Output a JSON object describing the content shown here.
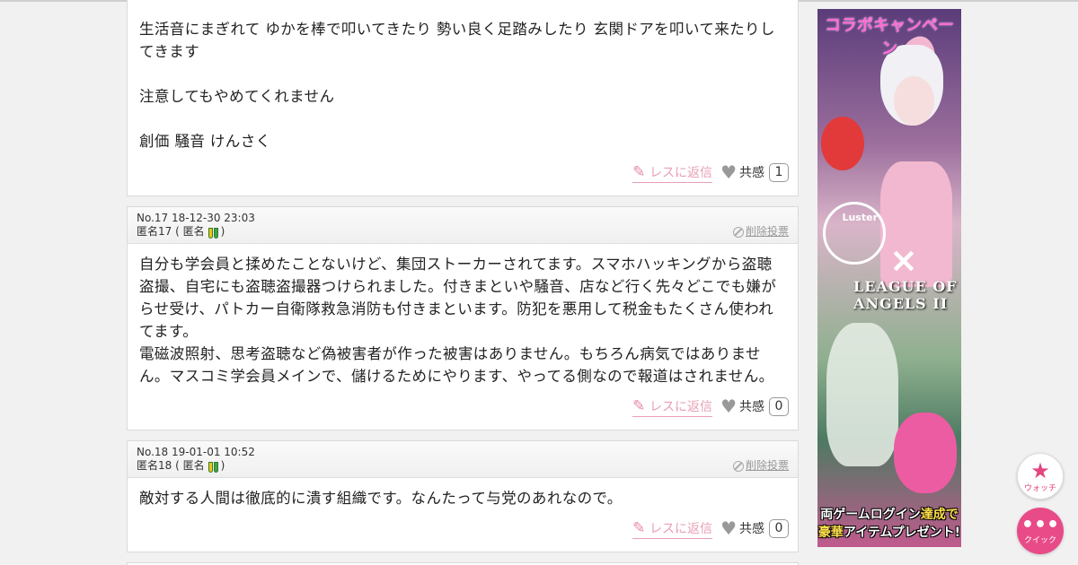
{
  "posts": [
    {
      "lines": [
        "生活音にまぎれて ゆかを棒で叩いてきたり 勢い良く足踏みしたり 玄関ドアを叩いて来たりしてきます",
        "",
        "注意してもやめてくれません",
        "",
        "創価 騒音 けんさく"
      ],
      "reply_label": "レスに返信",
      "sympathy_label": "共感",
      "sympathy_count": "1"
    },
    {
      "meta": "No.17 18-12-30 23:03",
      "author": "匿名17 ( 匿名",
      "author_close": ")",
      "delete_label": "削除投票",
      "lines": [
        "自分も学会員と揉めたことないけど、集団ストーカーされてます。スマホハッキングから盗聴盗撮、自宅にも盗聴盗撮器つけられました。付きまといや騒音、店など行く先々どこでも嫌がらせ受け、パトカー自衛隊救急消防も付きまといます。防犯を悪用して税金もたくさん使われてます。",
        "電磁波照射、思考盗聴など偽被害者が作った被害はありません。もちろん病気ではありません。マスコミ学会員メインで、儲けるためにやります、やってる側なので報道はされません。"
      ],
      "reply_label": "レスに返信",
      "sympathy_label": "共感",
      "sympathy_count": "0"
    },
    {
      "meta": "No.18 19-01-01 10:52",
      "author": "匿名18 ( 匿名",
      "author_close": ")",
      "delete_label": "削除投票",
      "lines": [
        "敵対する人間は徹底的に潰す組織です。なんたって与党のあれなので。"
      ],
      "reply_label": "レスに返信",
      "sympathy_label": "共感",
      "sympathy_count": "0"
    }
  ],
  "ad": {
    "title": "コラボキャンペーン",
    "logo1": "Luster",
    "logo2": "LEAGUE OF ANGELS II",
    "footer_line1_a": "両ゲームログイン",
    "footer_line1_b": "達成で",
    "footer_line2_a": "豪華",
    "footer_line2_b": "アイテムプレゼント!"
  },
  "fabs": {
    "watch_label": "ウォッチ",
    "quick_label": "クイック"
  },
  "colors": {
    "accent_pink": "#e84b88",
    "reply_pink": "#e8a0b4"
  }
}
